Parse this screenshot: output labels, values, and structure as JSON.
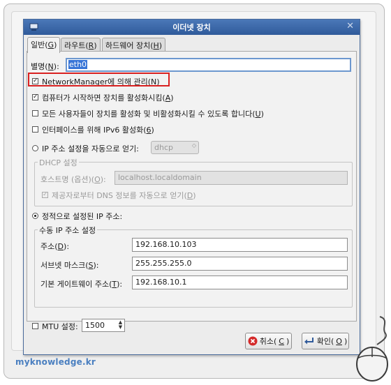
{
  "window": {
    "title": "이더넷 장치"
  },
  "tabs": [
    {
      "label": "일반(",
      "key": "G",
      "close": ")"
    },
    {
      "label": "라우트(",
      "key": "R",
      "close": ")"
    },
    {
      "label": "하드웨어 장치(",
      "key": "H",
      "close": ")"
    }
  ],
  "nickname": {
    "label": "별명(",
    "key": "N",
    "close": "):",
    "value": "eth0"
  },
  "checkboxes": [
    {
      "label": "NetworkManager에 의해 관리(",
      "key": "N",
      "close": ")",
      "checked": true
    },
    {
      "label": "컴퓨터가 시작하면 장치를 활성화시킴(",
      "key": "A",
      "close": ")",
      "checked": true
    },
    {
      "label": "모든 사용자들이 장치를 활성화 및 비활성화시킬 수 있도록 합니다(",
      "key": "U",
      "close": ")",
      "checked": false
    },
    {
      "label": "인터페이스를 위해 IPv6 활성화(",
      "key": "6",
      "close": ")",
      "checked": false
    }
  ],
  "auto_ip": {
    "label": "IP 주소 설정을 자동으로 얻기:",
    "dropdown_value": "dhcp"
  },
  "dhcp": {
    "group_title": "DHCP 설정",
    "hostname_label": "호스트명 (옵션)(",
    "hostname_key": "O",
    "hostname_close": "):",
    "hostname_value": "localhost.localdomain",
    "dns_label": "제공자로부터 DNS 정보를 자동으로 얻기(",
    "dns_key": "D",
    "dns_close": ")"
  },
  "static_ip": {
    "label": "정적으로 설정된 IP 주소:",
    "group_title": "수동 IP 주소 설정",
    "fields": [
      {
        "label": "주소(",
        "key": "D",
        "close": "):",
        "value": "192.168.10.103"
      },
      {
        "label": "서브넷 마스크(",
        "key": "S",
        "close": "):",
        "value": "255.255.255.0"
      },
      {
        "label": "기본 게이트웨이 주소(",
        "key": "T",
        "close": "):",
        "value": "192.168.10.1"
      }
    ]
  },
  "mtu": {
    "label": "MTU 설정:",
    "value": "1500"
  },
  "buttons": {
    "cancel": {
      "label": "취소(",
      "key": "C",
      "close": ")"
    },
    "ok": {
      "label": "확인(",
      "key": "O",
      "close": ")"
    }
  },
  "watermark": "myknowledge.kr"
}
